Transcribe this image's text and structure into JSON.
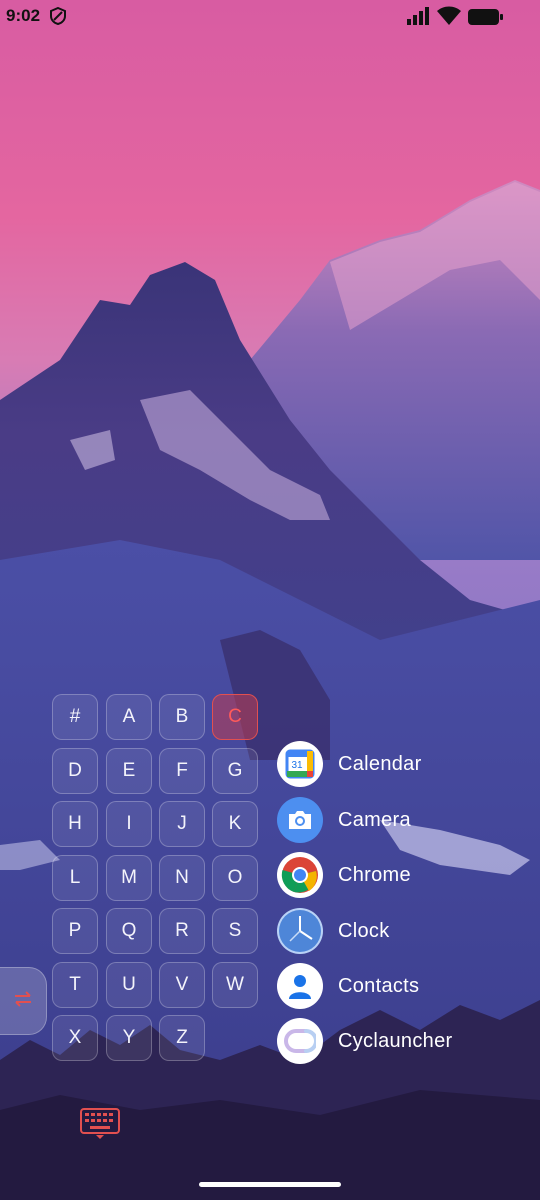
{
  "status_bar": {
    "time": "9:02",
    "icons": [
      "shield-icon",
      "signal-icon",
      "wifi-icon",
      "battery-icon"
    ]
  },
  "letter_grid": {
    "keys": [
      "#",
      "A",
      "B",
      "C",
      "D",
      "E",
      "F",
      "G",
      "H",
      "I",
      "J",
      "K",
      "L",
      "M",
      "N",
      "O",
      "P",
      "Q",
      "R",
      "S",
      "T",
      "U",
      "V",
      "W",
      "X",
      "Y",
      "Z"
    ],
    "selected": "C"
  },
  "apps": [
    {
      "label": "Calendar",
      "icon": "calendar-icon",
      "badge": "31"
    },
    {
      "label": "Camera",
      "icon": "camera-icon"
    },
    {
      "label": "Chrome",
      "icon": "chrome-icon"
    },
    {
      "label": "Clock",
      "icon": "clock-icon"
    },
    {
      "label": "Contacts",
      "icon": "contacts-icon"
    },
    {
      "label": "Cyclauncher",
      "icon": "cyclauncher-icon"
    }
  ],
  "colors": {
    "accent": "#e25050",
    "sky_top": "#e2609e",
    "mountain": "#4a4fa8"
  },
  "controls": {
    "side_handle_icon": "swap-arrows-icon",
    "keyboard_icon": "keyboard-icon"
  }
}
